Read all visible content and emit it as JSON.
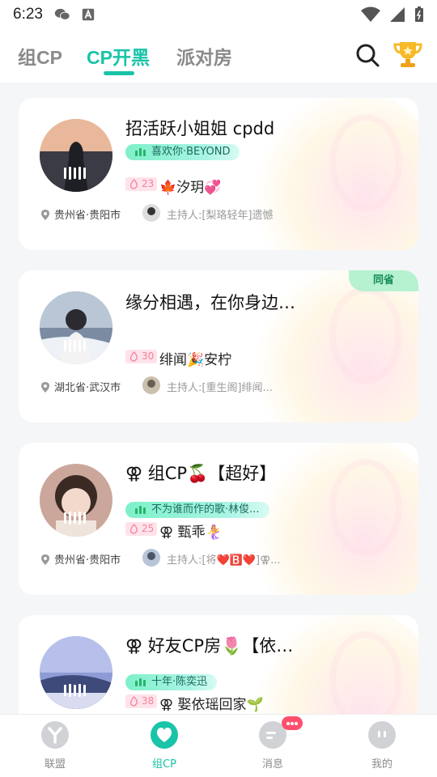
{
  "status_bar": {
    "time": "6:23"
  },
  "tabs": [
    {
      "label": "组CP",
      "active": false
    },
    {
      "label": "CP开黑",
      "active": true
    },
    {
      "label": "派对房",
      "active": false
    }
  ],
  "header_icons": {
    "search": "search-icon",
    "rank": "trophy-icon"
  },
  "rooms": [
    {
      "title": "招活跃小姐姐 cpdd",
      "song": "喜欢你·BEYOND",
      "heat": "23",
      "member": "🍁汐玥💞",
      "location": "贵州省·贵阳市",
      "host": "主持人:[梨珞轻年]遗憾",
      "badge": ""
    },
    {
      "title": "缘分相遇，在你身边…",
      "song": "",
      "heat": "30",
      "member": "绯闻🎉安柠",
      "location": "湖北省·武汉市",
      "host": "主持人:[重生阁]绯闻...",
      "badge": "同省"
    },
    {
      "title": "⚢ 组CP🍒【超好】",
      "song": "不为谁而作的歌·林俊...",
      "heat": "25",
      "member": "⚢ 甄乖🧜‍♀️",
      "location": "贵州省·贵阳市",
      "host": "主持人:[将❤️🅱️❤️]⚢...",
      "badge": ""
    },
    {
      "title": "⚢ 好友CP房🌷【依…",
      "song": "十年·陈奕迅",
      "heat": "38",
      "member": "⚢ 娶依瑶回家🌱",
      "location": "",
      "host": "",
      "badge": ""
    }
  ],
  "bottom_nav": [
    {
      "label": "联盟",
      "active": false
    },
    {
      "label": "组CP",
      "active": true
    },
    {
      "label": "消息",
      "active": false
    },
    {
      "label": "我的",
      "active": false
    }
  ],
  "colors": {
    "accent": "#19c4a8",
    "heat": "#f2829d",
    "badge": "#b6f1d0"
  }
}
